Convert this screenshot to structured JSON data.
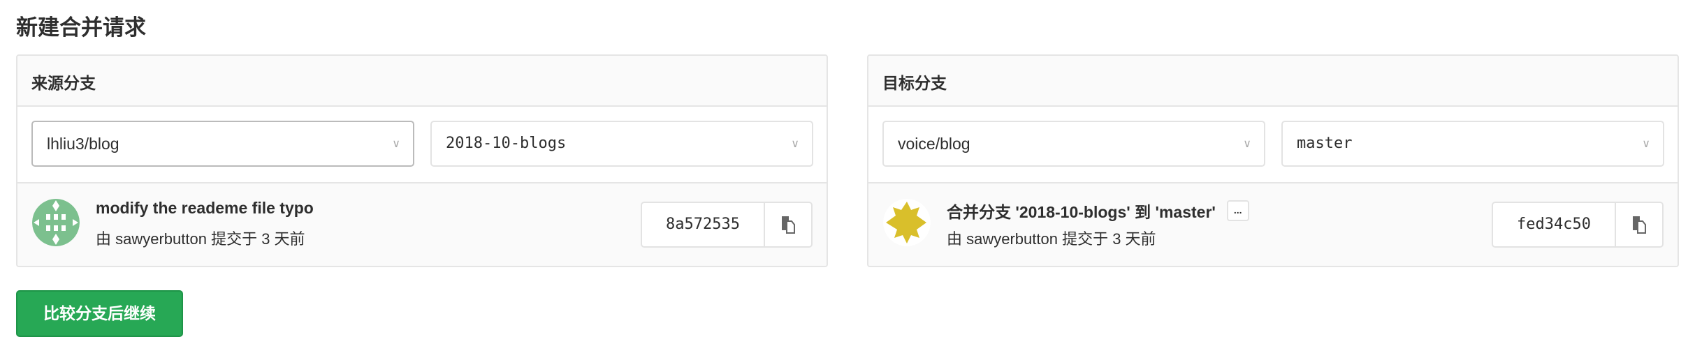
{
  "page_title": "新建合并请求",
  "source": {
    "heading": "来源分支",
    "project": "lhliu3/blog",
    "branch": "2018-10-blogs",
    "commit": {
      "title": "modify the reademe file typo",
      "meta": "由 sawyerbutton 提交于 3 天前",
      "sha": "8a572535",
      "avatar_color": "#7cc08e"
    }
  },
  "target": {
    "heading": "目标分支",
    "project": "voice/blog",
    "branch": "master",
    "commit": {
      "title": "合并分支 '2018-10-blogs' 到 'master'",
      "ellipsis": "...",
      "meta": "由 sawyerbutton 提交于 3 天前",
      "sha": "fed34c50",
      "avatar_color": "#d9bf2b"
    }
  },
  "compare_button": "比较分支后继续",
  "colors": {
    "accent": "#27a855"
  }
}
